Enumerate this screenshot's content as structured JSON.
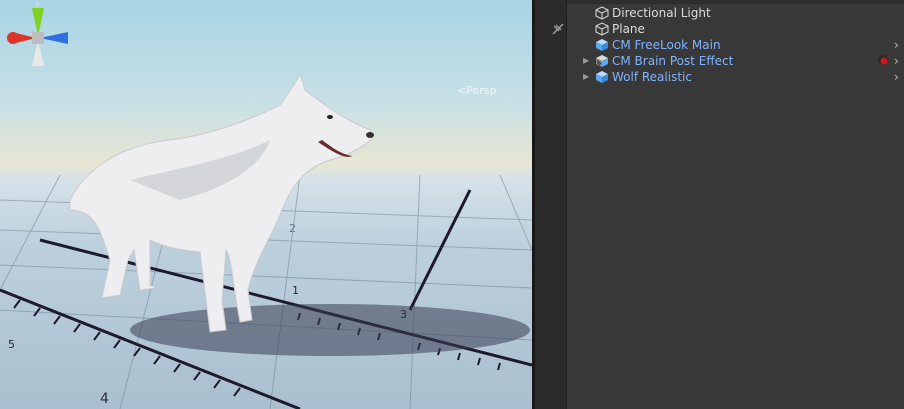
{
  "scene_view": {
    "gizmo": {
      "axis_y": "y"
    },
    "projection_label": "<Persp",
    "ruler_labels": [
      "1",
      "2",
      "3",
      "4",
      "5"
    ]
  },
  "hierarchy": {
    "items": [
      {
        "label": "Directional Light",
        "type": "gameobject",
        "expandable": false,
        "icon": "cube-outline-icon"
      },
      {
        "label": "Plane",
        "type": "gameobject",
        "expandable": false,
        "icon": "cube-outline-icon"
      },
      {
        "label": "CM FreeLook Main",
        "type": "prefab",
        "expandable": false,
        "icon": "prefab-cube-icon"
      },
      {
        "label": "CM Brain Post Effect",
        "type": "prefab",
        "expandable": true,
        "icon": "prefab-variant-icon"
      },
      {
        "label": "Wolf Realistic",
        "type": "prefab",
        "expandable": true,
        "icon": "prefab-cube-icon"
      }
    ]
  },
  "colors": {
    "prefab_text": "#7fb3ff",
    "normal_text": "#dcdcdc",
    "panel_bg": "#383838",
    "gizmo_x": "#e0332a",
    "gizmo_y": "#7ed321",
    "gizmo_z": "#2f6fe0"
  }
}
